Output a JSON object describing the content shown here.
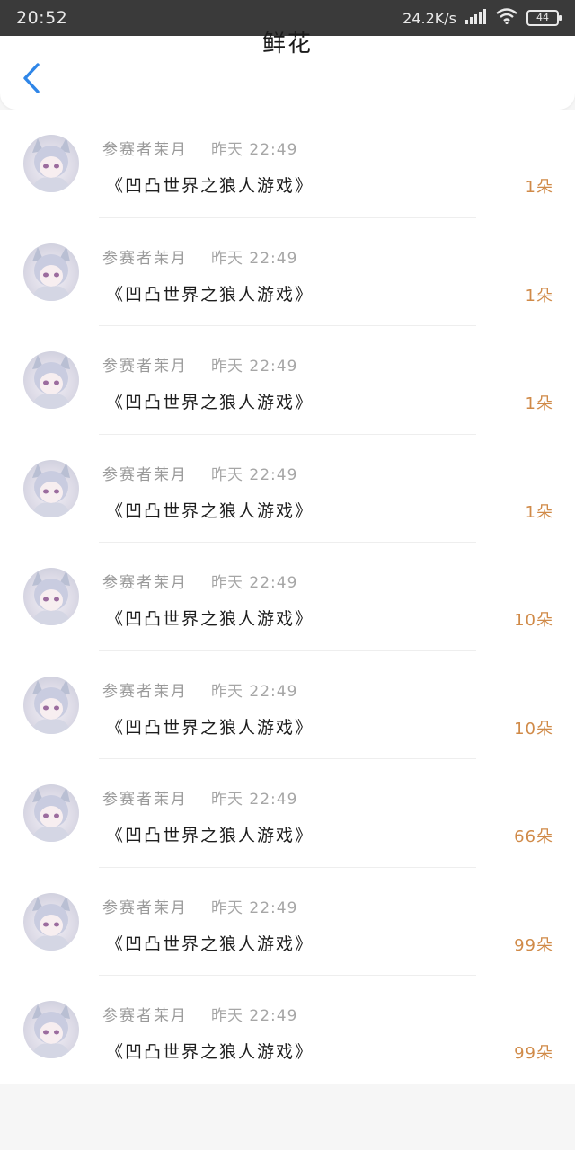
{
  "status_bar": {
    "time": "20:52",
    "net_speed": "24.2K/s",
    "battery": "44"
  },
  "header": {
    "title": "鲜花",
    "back_icon": "chevron-left-icon",
    "accent_color": "#2f86e8"
  },
  "gifts": [
    {
      "sender": "参赛者茉月",
      "time": "昨天 22:49",
      "work": "《凹凸世界之狼人游戏》",
      "count": "1朵"
    },
    {
      "sender": "参赛者茉月",
      "time": "昨天 22:49",
      "work": "《凹凸世界之狼人游戏》",
      "count": "1朵"
    },
    {
      "sender": "参赛者茉月",
      "time": "昨天 22:49",
      "work": "《凹凸世界之狼人游戏》",
      "count": "1朵"
    },
    {
      "sender": "参赛者茉月",
      "time": "昨天 22:49",
      "work": "《凹凸世界之狼人游戏》",
      "count": "1朵"
    },
    {
      "sender": "参赛者茉月",
      "time": "昨天 22:49",
      "work": "《凹凸世界之狼人游戏》",
      "count": "10朵"
    },
    {
      "sender": "参赛者茉月",
      "time": "昨天 22:49",
      "work": "《凹凸世界之狼人游戏》",
      "count": "10朵"
    },
    {
      "sender": "参赛者茉月",
      "time": "昨天 22:49",
      "work": "《凹凸世界之狼人游戏》",
      "count": "66朵"
    },
    {
      "sender": "参赛者茉月",
      "time": "昨天 22:49",
      "work": "《凹凸世界之狼人游戏》",
      "count": "99朵"
    },
    {
      "sender": "参赛者茉月",
      "time": "昨天 22:49",
      "work": "《凹凸世界之狼人游戏》",
      "count": "99朵"
    }
  ],
  "colors": {
    "count_color": "#d08a48",
    "status_bar_bg": "#3a3a3a"
  }
}
